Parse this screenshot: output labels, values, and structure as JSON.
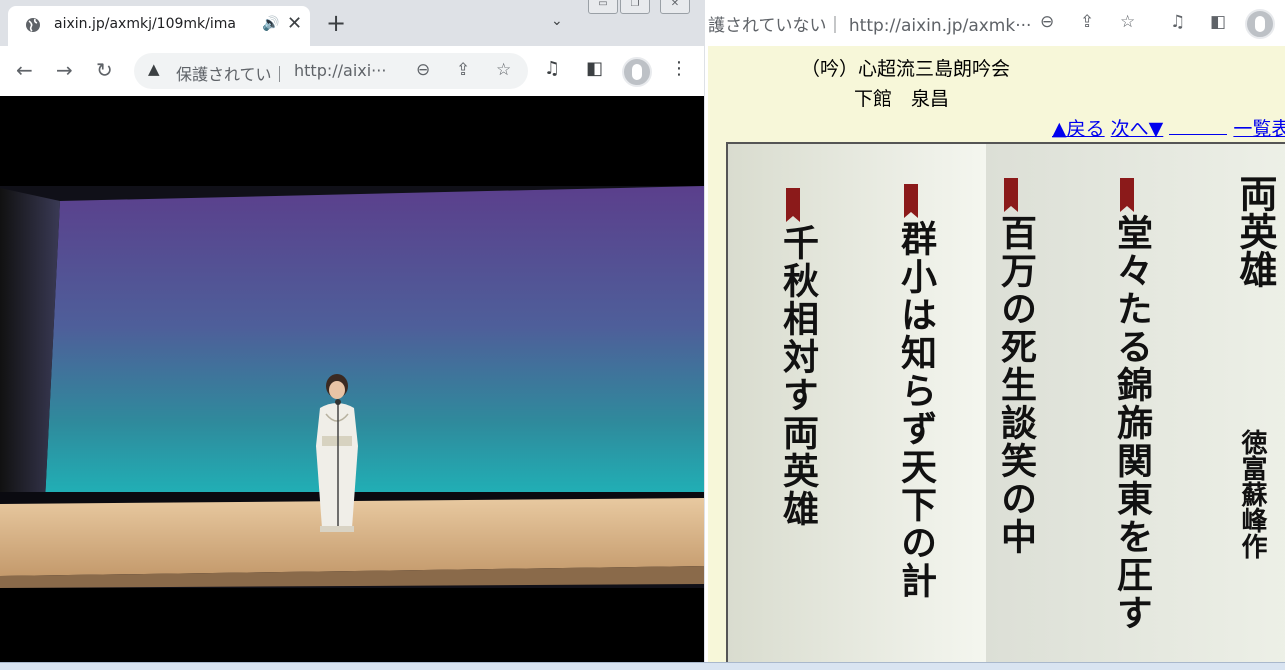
{
  "left_window": {
    "tab": {
      "title": "aixin.jp/axmkj/109mk/ima"
    },
    "address_bar": {
      "security_text": "保護されてい｜",
      "url": "http://aixi···"
    }
  },
  "right_window": {
    "address_bar": {
      "text": "護されていない｜ http://aixin.jp/axmk···"
    },
    "page": {
      "ginkai": "（吟）心超流三島朗吟会",
      "performer": "下館　泉昌",
      "nav": {
        "back": "▲戻る",
        "next": "次へ▼",
        "list": "一覧表"
      },
      "poem": {
        "title": "両英雄",
        "author": "徳富蘇峰作",
        "lines": [
          "堂々たる錦旆関東を圧す",
          "百万の死生談笑の中",
          "群小は知らず天下の計",
          "千秋相対す両英雄"
        ]
      }
    }
  },
  "colors": {
    "link": "#0000ee",
    "page_bg": "#f7f7d9",
    "bookmark": "#8b1a1a"
  }
}
